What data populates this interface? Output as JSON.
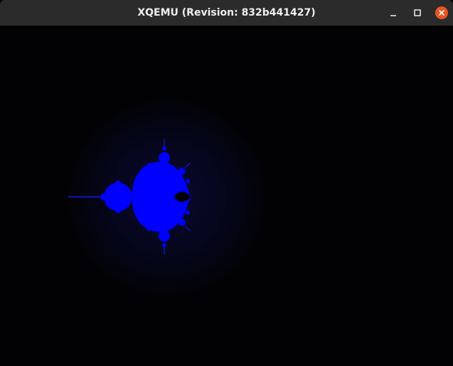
{
  "window": {
    "title": "XQEMU (Revision: 832b441427)",
    "controls": {
      "minimize_icon": "minimize-icon",
      "maximize_icon": "maximize-icon",
      "close_icon": "close-icon"
    },
    "colors": {
      "titlebar": "#2b2b2b",
      "title_text": "#efefef",
      "close_button": "#e95420",
      "screen_background": "#020204",
      "fractal_color": "#0000ff"
    }
  },
  "screen": {
    "content": "mandelbrot-fractal"
  }
}
